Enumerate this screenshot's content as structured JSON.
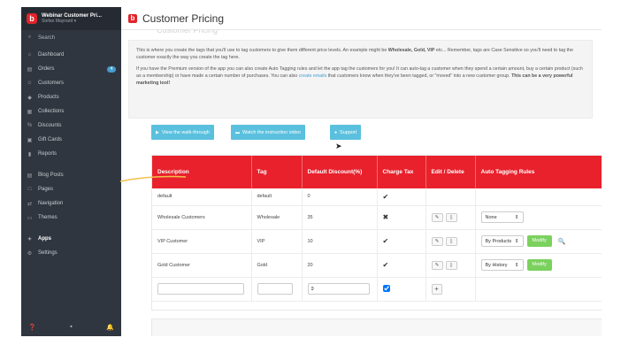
{
  "store": {
    "name": "Webinar Customer Pri...",
    "user": "Stefan Maynard ▾"
  },
  "sidebar": {
    "search": "Search",
    "items": [
      {
        "label": "Dashboard",
        "icon": "home-icon",
        "glyph": "⌂"
      },
      {
        "label": "Orders",
        "icon": "orders-icon",
        "glyph": "▤",
        "badge": "4"
      },
      {
        "label": "Customers",
        "icon": "customers-icon",
        "glyph": "☺"
      },
      {
        "label": "Products",
        "icon": "tag-icon",
        "glyph": "◆"
      },
      {
        "label": "Collections",
        "icon": "collections-icon",
        "glyph": "▦"
      },
      {
        "label": "Discounts",
        "icon": "discounts-icon",
        "glyph": "%"
      },
      {
        "label": "Gift Cards",
        "icon": "gift-icon",
        "glyph": "▣"
      },
      {
        "label": "Reports",
        "icon": "reports-icon",
        "glyph": "▮"
      },
      {
        "label": "Blog Posts",
        "icon": "blog-icon",
        "glyph": "▤"
      },
      {
        "label": "Pages",
        "icon": "pages-icon",
        "glyph": "□"
      },
      {
        "label": "Navigation",
        "icon": "navigation-icon",
        "glyph": "⇄"
      },
      {
        "label": "Themes",
        "icon": "themes-icon",
        "glyph": "▭"
      },
      {
        "label": "Apps",
        "icon": "apps-icon",
        "glyph": "✦"
      },
      {
        "label": "Settings",
        "icon": "settings-icon",
        "glyph": "⚙"
      }
    ]
  },
  "header": {
    "title": "Customer Pricing",
    "ghost_title": "Customer Pricing"
  },
  "info": {
    "p1_a": "This is where you create the tags that you'll use to tag customers to give them different price levels. An example might be ",
    "p1_bold": "Wholesale, Gold, VIP",
    "p1_b": " etc... Remember, tags are Case Sensitive so you'll need to tag the customer exactly the way you create the tag here.",
    "p2_a": "If you have the Premium version of the app you can also create Auto Tagging rules and let the app tag the customers for you! It can auto-tag a customer when they spend a certain amount, buy a certain product (such as a membership) or have made a certain number of purchases. You can also ",
    "p2_link": "create emails",
    "p2_b": " that customers know when they've been tagged, or \"moved\" into a new customer group. ",
    "p2_bold": "This can be a very powerful marketing tool!"
  },
  "buttons": {
    "walkthrough": "View the walk-through",
    "video": "Watch the instruction video",
    "support": "Support"
  },
  "table": {
    "headers": {
      "description": "Description",
      "tag": "Tag",
      "discount": "Default Discount(%)",
      "charge_tax": "Charge Tax",
      "edit": "Edit / Delete",
      "auto": "Auto Tagging Rules"
    },
    "rows": [
      {
        "description": "default",
        "tag": "default",
        "discount": "0",
        "tax": "✔"
      },
      {
        "description": "Wholesale Customers",
        "tag": "Wholesale",
        "discount": "35",
        "tax": "✖",
        "rule": "None"
      },
      {
        "description": "VIP Customer",
        "tag": "VIP",
        "discount": "10",
        "tax": "✔",
        "rule": "By Products",
        "modify": "Modify"
      },
      {
        "description": "Gold Customer",
        "tag": "Gold",
        "discount": "20",
        "tax": "✔",
        "rule": "By History",
        "modify": "Modify"
      }
    ],
    "new_row": {
      "discount": "0"
    }
  },
  "colors": {
    "accent": "#e8212c",
    "sidebar": "#30363f",
    "button": "#5bc0de",
    "modify": "#7bd15d"
  }
}
